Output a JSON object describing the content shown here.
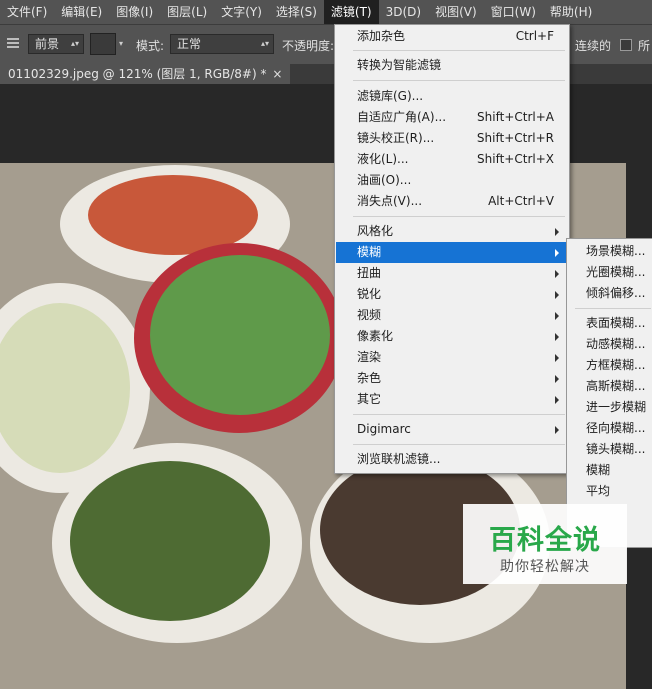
{
  "menubar": {
    "items": [
      "文件(F)",
      "编辑(E)",
      "图像(I)",
      "图层(L)",
      "文字(Y)",
      "选择(S)",
      "滤镜(T)",
      "3D(D)",
      "视图(V)",
      "窗口(W)",
      "帮助(H)"
    ],
    "active_index": 6
  },
  "options": {
    "source_value": "前景",
    "mode_label": "模式:",
    "mode_value": "正常",
    "opacity_label": "不透明度:",
    "contiguous_label": "连续的",
    "all_layers_label": "所"
  },
  "document": {
    "tab_title": "01102329.jpeg @ 121% (图层 1, RGB/8#) *",
    "close_glyph": "×"
  },
  "filter_menu": {
    "add_noise": {
      "label": "添加杂色",
      "shortcut": "Ctrl+F"
    },
    "convert_smart": {
      "label": "转换为智能滤镜"
    },
    "gallery": {
      "label": "滤镜库(G)..."
    },
    "adaptive_wide": {
      "label": "自适应广角(A)...",
      "shortcut": "Shift+Ctrl+A"
    },
    "lens_correction": {
      "label": "镜头校正(R)...",
      "shortcut": "Shift+Ctrl+R"
    },
    "liquify": {
      "label": "液化(L)...",
      "shortcut": "Shift+Ctrl+X"
    },
    "oil_paint": {
      "label": "油画(O)..."
    },
    "vanishing_point": {
      "label": "消失点(V)...",
      "shortcut": "Alt+Ctrl+V"
    },
    "stylize": {
      "label": "风格化"
    },
    "blur": {
      "label": "模糊"
    },
    "distort": {
      "label": "扭曲"
    },
    "sharpen": {
      "label": "锐化"
    },
    "video": {
      "label": "视频"
    },
    "pixelate": {
      "label": "像素化"
    },
    "render": {
      "label": "渲染"
    },
    "noise": {
      "label": "杂色"
    },
    "other": {
      "label": "其它"
    },
    "digimarc": {
      "label": "Digimarc"
    },
    "browse_online": {
      "label": "浏览联机滤镜..."
    }
  },
  "blur_submenu": {
    "field_blur": "场景模糊...",
    "iris_blur": "光圈模糊...",
    "tilt_shift": "倾斜偏移...",
    "surface_blur": "表面模糊...",
    "motion_blur": "动感模糊...",
    "box_blur": "方框模糊...",
    "gaussian_blur": "高斯模糊...",
    "blur_more": "进一步模糊",
    "radial_blur": "径向模糊...",
    "lens_blur": "镜头模糊...",
    "blur": "模糊",
    "average": "平均"
  },
  "watermark": {
    "title": "百科全说",
    "subtitle": "助你轻松解决"
  },
  "colors": {
    "menu_highlight": "#1673d4",
    "menubar_bg": "#535353",
    "watermark_green": "#29a84a"
  }
}
